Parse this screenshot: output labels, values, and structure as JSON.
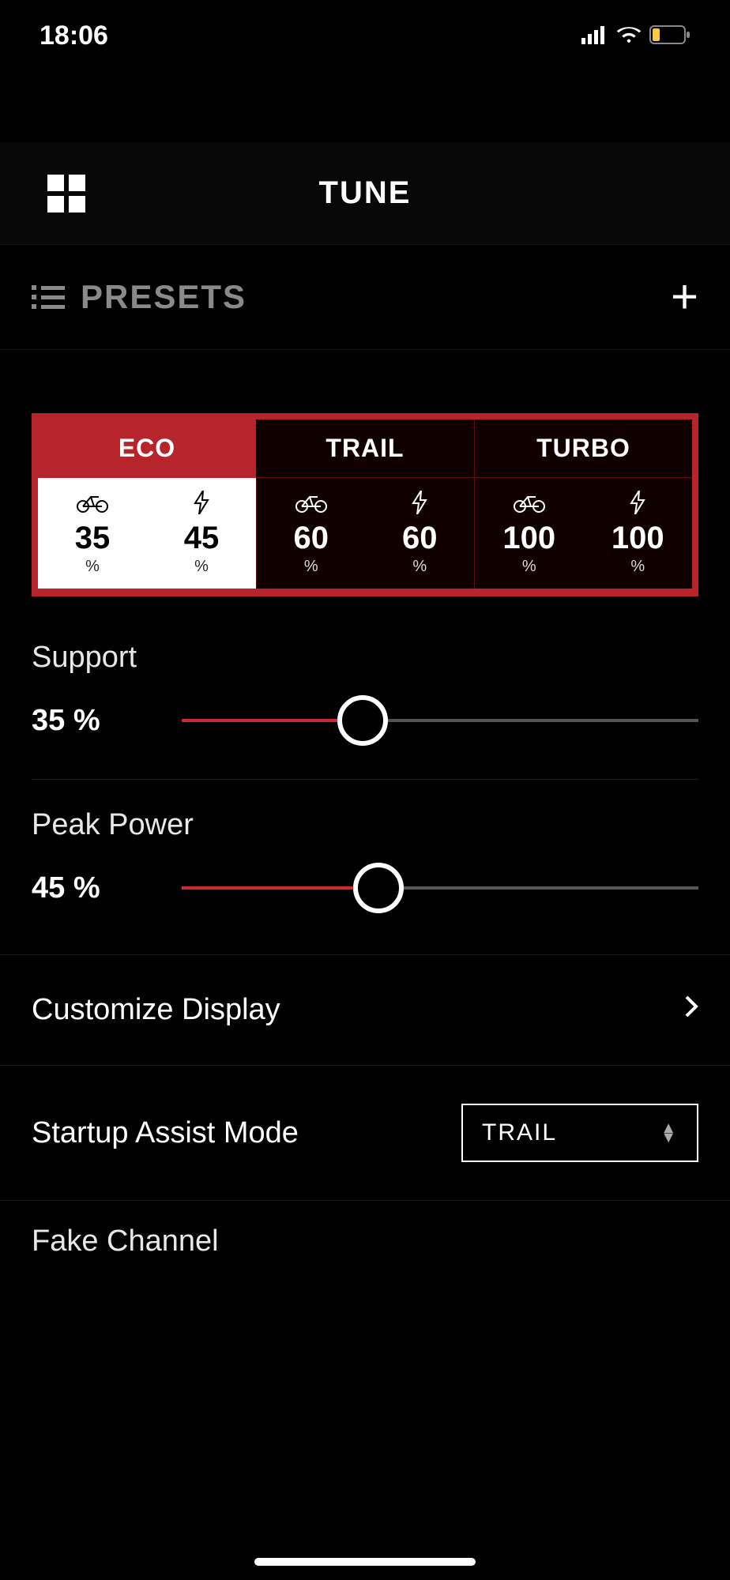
{
  "status": {
    "time": "18:06"
  },
  "header": {
    "title": "TUNE"
  },
  "presets": {
    "label": "PRESETS"
  },
  "modes": {
    "eco": {
      "label": "ECO",
      "support": "35",
      "power": "45"
    },
    "trail": {
      "label": "TRAIL",
      "support": "60",
      "power": "60"
    },
    "turbo": {
      "label": "TURBO",
      "support": "100",
      "power": "100"
    },
    "unit": "%"
  },
  "sliders": {
    "support": {
      "label": "Support",
      "value": "35 %",
      "percent": 35
    },
    "peakpower": {
      "label": "Peak Power",
      "value": "45 %",
      "percent": 45
    }
  },
  "menu": {
    "customize": "Customize Display",
    "startup": {
      "label": "Startup Assist Mode",
      "value": "TRAIL"
    },
    "fake": "Fake Channel"
  }
}
